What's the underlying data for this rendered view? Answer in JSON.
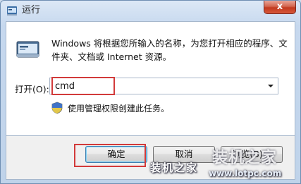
{
  "window": {
    "title": "运行",
    "close_label": "x"
  },
  "dialog": {
    "description": "Windows 将根据您所输入的名称，为您打开相应的程序、文件夹、文档或 Internet 资源。",
    "open_label": "打开(O):",
    "command_value": "cmd",
    "admin_note": "使用管理权限创建此任务。"
  },
  "buttons": {
    "ok": "确定",
    "cancel": "取消",
    "browse": "浏览(B)..."
  },
  "watermark": {
    "site_name": "装机之家",
    "big_text": "装机之家",
    "url": "www.lotpc.com"
  },
  "colors": {
    "highlight_box": "#d23a3a",
    "title_bar": "#c6d8ee",
    "close_button": "#c2391e"
  }
}
